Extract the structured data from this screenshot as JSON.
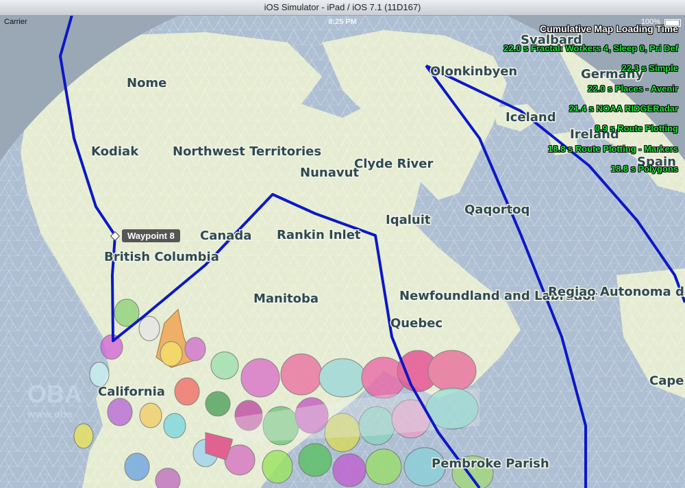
{
  "window": {
    "title": "iOS Simulator - iPad / iOS 7.1 (11D167)"
  },
  "status_bar": {
    "carrier": "Carrier",
    "time": "8:25 PM",
    "battery": "100%"
  },
  "timing_panel": {
    "header": "Cumulative Map Loading Time",
    "rows": [
      "22.0 s Fractal: Workers 4, Sleep 0, Pri Def",
      "22.3 s Simple",
      "22.0 s Places - Avenir",
      "21.4 s NOAA RIDGERadar",
      "0.9 s Route Plotting",
      "18.8 s Route Plotting - Markers",
      "18.8 s Polygons"
    ]
  },
  "waypoint": {
    "label": "Waypoint 8"
  },
  "places": {
    "svalbard": "Svalbard",
    "nome": "Nome",
    "olonkinbyen": "Olonkinbyen",
    "germany": "Germany",
    "iceland": "Iceland",
    "ireland": "Ireland",
    "kodiak": "Kodiak",
    "northwest_territories": "Northwest Territories",
    "nunavut": "Nunavut",
    "clyde_river": "Clyde River",
    "spain": "Spain",
    "qaqortoq": "Qaqortoq",
    "iqaluit": "Iqaluit",
    "canada": "Canada",
    "rankin_inlet": "Rankin Inlet",
    "british_columbia": "British Columbia",
    "manitoba": "Manitoba",
    "newfoundland": "Newfoundland and Labrador",
    "regiao": "Regiao Autonoma do",
    "quebec": "Quebec",
    "california": "California",
    "cape": "Cape",
    "pembroke": "Pembroke Parish"
  },
  "watermark": {
    "logo": "OBA",
    "sub": "www.oba"
  },
  "colors": {
    "ocean": "#aebfd3",
    "land": "#e6ecd2",
    "route": "#0b18c6",
    "label_text": "#2f4a50",
    "timing_text": "#23e040"
  },
  "icons": {
    "waypoint_marker": "diamond-marker-icon",
    "battery": "battery-icon"
  }
}
